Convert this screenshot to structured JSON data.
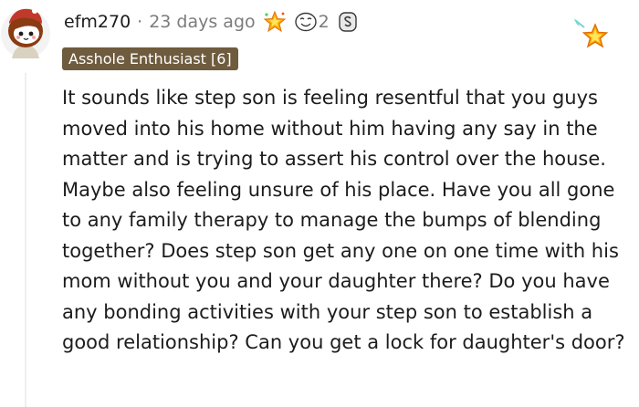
{
  "comment": {
    "username": "efm270",
    "separator": "·",
    "timestamp": "23 days ago",
    "awards": [
      {
        "icon": "starstruck-award-icon"
      },
      {
        "icon": "face-award-icon",
        "count": "2"
      },
      {
        "icon": "silver-award-icon"
      }
    ],
    "flair": "Asshole Enthusiast [6]",
    "body": "It sounds like step son is feeling resentful that you guys moved into his home without him having any say in the matter and is trying to assert his control over the house. Maybe also feeling unsure of his place. Have you all gone to any family therapy to manage the bumps of blending together? Does step son get any one on one time with his mom without you and your daughter there? Do you have any bonding activities with your step son to establish a good relationship? Can you get a lock for daughter's door?"
  },
  "colors": {
    "flair_bg": "#6f5b3e",
    "meta_text": "#7c7c7c",
    "body_text": "#1c1c1c",
    "star_fill": "#ffb000"
  }
}
